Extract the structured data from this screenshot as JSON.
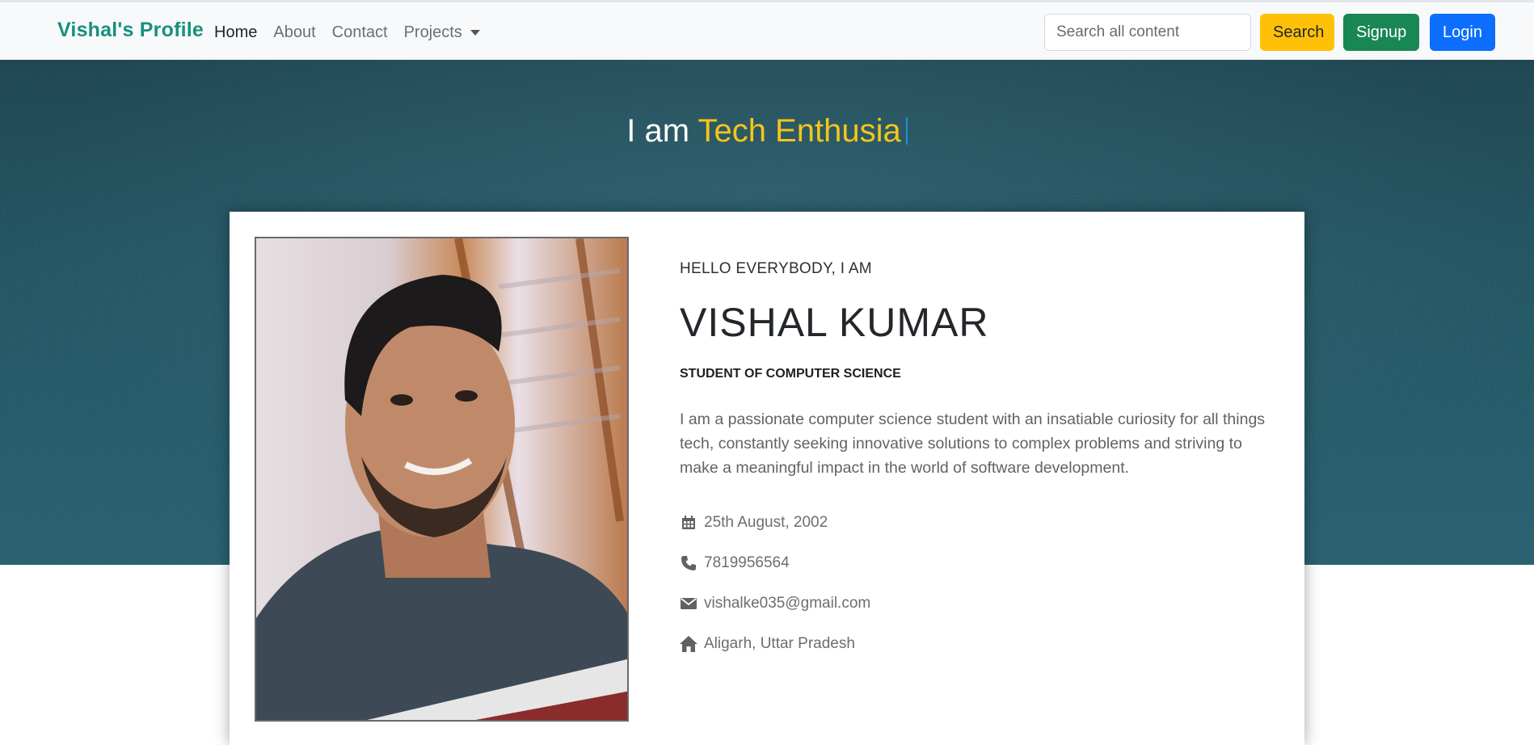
{
  "navbar": {
    "brand": "Vishal's Profile",
    "links": [
      {
        "label": "Home"
      },
      {
        "label": "About"
      },
      {
        "label": "Contact"
      },
      {
        "label": "Projects"
      }
    ],
    "search_placeholder": "Search all content",
    "search_button": "Search",
    "signup_button": "Signup",
    "login_button": "Login"
  },
  "hero": {
    "prefix": "I am",
    "typed_word": "Tech Enthusia"
  },
  "profile": {
    "greeting": "HELLO EVERYBODY, I AM",
    "name": "VISHAL KUMAR",
    "role": "STUDENT OF COMPUTER SCIENCE",
    "bio": "I am a passionate computer science student with an insatiable curiosity for all things tech, constantly seeking innovative solutions to complex problems and striving to make a meaningful impact in the world of software development.",
    "details": [
      {
        "icon": "calendar-icon",
        "text": "25th August, 2002"
      },
      {
        "icon": "phone-icon",
        "text": "7819956564"
      },
      {
        "icon": "envelope-icon",
        "text": "vishalke035@gmail.com"
      },
      {
        "icon": "home-icon",
        "text": "Aligarh, Uttar Pradesh"
      }
    ]
  },
  "colors": {
    "brand": "#17907f",
    "accent": "#f5c518",
    "search_btn": "#ffc107",
    "signup_btn": "#198754",
    "login_btn": "#0d6efd"
  }
}
